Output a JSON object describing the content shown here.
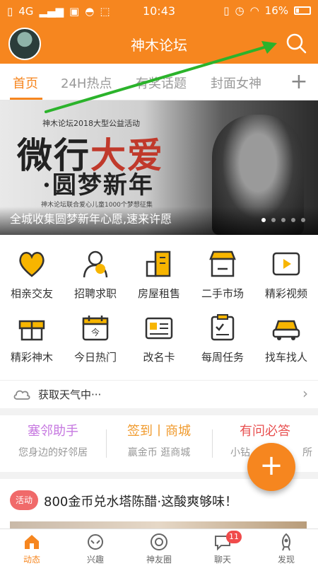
{
  "status_bar": {
    "network": "4G",
    "time": "10:43",
    "battery": "16%"
  },
  "app_bar": {
    "title": "神木论坛"
  },
  "tabs": [
    {
      "label": "首页",
      "active": true
    },
    {
      "label": "24H热点"
    },
    {
      "label": "有奖话题"
    },
    {
      "label": "封面女神"
    }
  ],
  "tab_add": "+",
  "banner": {
    "event": "神木论坛2018大型公益活动",
    "headline_1a": "微行",
    "headline_1b": "大爱",
    "headline_2": "·圆梦新年",
    "small": "神木论坛联合爱心儿童1000个梦想征集",
    "caption": "全城收集圆梦新年心愿,速来许愿"
  },
  "grid": [
    {
      "label": "相亲交友",
      "icon": "heart-icon"
    },
    {
      "label": "招聘求职",
      "icon": "person-icon"
    },
    {
      "label": "房屋租售",
      "icon": "building-icon"
    },
    {
      "label": "二手市场",
      "icon": "shop-icon"
    },
    {
      "label": "精彩视频",
      "icon": "video-icon"
    },
    {
      "label": "精彩神木",
      "icon": "gift-icon"
    },
    {
      "label": "今日热门",
      "icon": "calendar-icon"
    },
    {
      "label": "改名卡",
      "icon": "card-icon"
    },
    {
      "label": "每周任务",
      "icon": "task-icon"
    },
    {
      "label": "找车找人",
      "icon": "car-icon"
    }
  ],
  "weather": {
    "text": "获取天气中···"
  },
  "features": [
    {
      "title": "塞邻助手",
      "subtitle": "您身边的好邻居",
      "color": "#c678e0"
    },
    {
      "title": "签到丨商城",
      "subtitle": "赢金币 逛商城",
      "color": "#f09a2c"
    },
    {
      "title": "有问必答",
      "subtitle": "小钻",
      "subtitle_right": "所",
      "color": "#e85050"
    }
  ],
  "fab": "+",
  "news": {
    "badge": "活动",
    "headline": "800金币兑水塔陈醋·这酸爽够味！"
  },
  "bottom_nav": [
    {
      "label": "动态",
      "active": true
    },
    {
      "label": "兴趣"
    },
    {
      "label": "神友圈"
    },
    {
      "label": "聊天",
      "badge": "11"
    },
    {
      "label": "发现"
    }
  ],
  "colors": {
    "brand": "#f6861f",
    "icon_yellow": "#f7b500"
  }
}
